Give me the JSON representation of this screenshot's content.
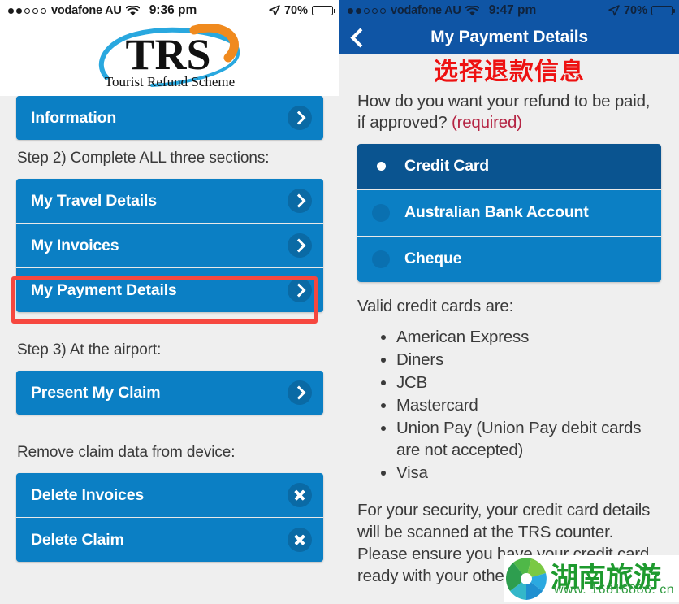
{
  "left": {
    "status_bar": {
      "signal_dots_filled": 2,
      "signal_dots_total": 5,
      "carrier": "vodafone AU",
      "wifi_icon": "wifi-icon",
      "time": "9:36 pm",
      "location_icon": "location-arrow-icon",
      "battery_percent": "70%",
      "battery_level": 70
    },
    "logo": {
      "title": "TRS",
      "subtitle": "Tourist Refund Scheme",
      "swoosh_color": "#29a8df",
      "arrow_color": "#f08a1e"
    },
    "partial_button": {
      "label": "Information",
      "icon": "chevron-right-icon"
    },
    "step2_heading": "Step 2) Complete ALL three sections:",
    "step2_buttons": [
      {
        "label": "My Travel Details",
        "icon": "chevron-right-icon"
      },
      {
        "label": "My Invoices",
        "icon": "chevron-right-icon"
      },
      {
        "label": "My Payment Details",
        "icon": "chevron-right-icon",
        "highlighted": true
      }
    ],
    "step3_heading": "Step 3) At the airport:",
    "step3_buttons": [
      {
        "label": "Present My Claim",
        "icon": "chevron-right-icon"
      }
    ],
    "remove_heading": "Remove claim data from device:",
    "remove_buttons": [
      {
        "label": "Delete Invoices",
        "icon": "close-x-icon"
      },
      {
        "label": "Delete Claim",
        "icon": "close-x-icon"
      }
    ],
    "highlight_color": "#f6473f",
    "button_color": "#0b7fc4"
  },
  "right": {
    "status_bar": {
      "signal_dots_filled": 2,
      "signal_dots_total": 5,
      "carrier": "vodafone AU",
      "wifi_icon": "wifi-icon",
      "time": "9:47 pm",
      "location_icon": "location-arrow-icon",
      "battery_percent": "70%",
      "battery_level": 70
    },
    "navbar": {
      "back_icon": "chevron-left-icon",
      "title": "My Payment Details",
      "color": "#0f55a5"
    },
    "annotation_cn": "选择退款信息",
    "annotation_color": "#ee1111",
    "question_main": "How do you want your refund to be paid, if approved? ",
    "question_required": "(required)",
    "options": [
      {
        "label": "Credit Card",
        "selected": true
      },
      {
        "label": "Australian Bank Account",
        "selected": false
      },
      {
        "label": "Cheque",
        "selected": false
      }
    ],
    "valid_cards_heading": "Valid credit cards are:",
    "valid_cards": [
      "American Express",
      "Diners",
      "JCB",
      "Mastercard",
      "Union Pay (Union Pay debit cards are not accepted)",
      "Visa"
    ],
    "security_text": "For your security, your credit card details will be scanned at the TRS counter. Please ensure you have your credit card ready with your other"
  },
  "watermark": {
    "logo_icon": "shutter-flower-icon",
    "text_cn": "湖南旅游",
    "url": "www. 16816886. cn",
    "color": "#1e9a2e"
  }
}
